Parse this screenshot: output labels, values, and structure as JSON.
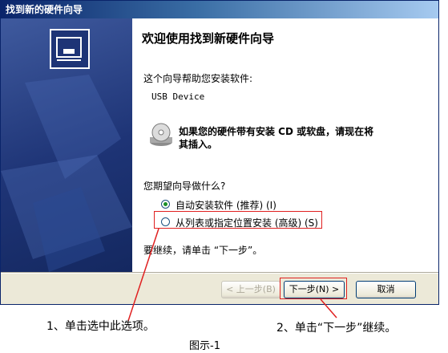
{
  "window": {
    "title": "找到新的硬件向导"
  },
  "content": {
    "heading": "欢迎使用找到新硬件向导",
    "intro": "这个向导帮助您安装软件:",
    "device": "USB Device",
    "cd_hint_line1": "如果您的硬件带有安装 CD 或软盘，请现在将",
    "cd_hint_line2": "其插入。",
    "question": "您期望向导做什么?",
    "options": [
      {
        "label": "自动安装软件 (推荐) (I)",
        "selected": true
      },
      {
        "label": "从列表或指定位置安装 (高级) (S)",
        "selected": false
      }
    ],
    "continue_text": "要继续，请单击 “下一步”。"
  },
  "buttons": {
    "back": "< 上一步(B)",
    "next": "下一步(N) >",
    "cancel": "取消"
  },
  "annotations": {
    "note1": "1、单击选中此选项。",
    "note2": "2、单击“下一步”继续。",
    "caption": "图示-1"
  },
  "colors": {
    "title_bar": "#0a246a",
    "banner": "#1e3476",
    "highlight": "#e02020"
  }
}
